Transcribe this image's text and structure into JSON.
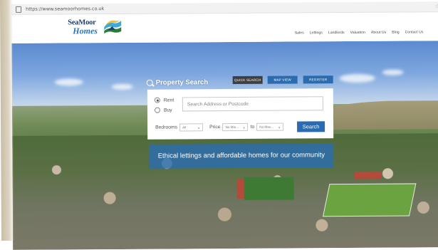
{
  "browser": {
    "url": "https://www.seamoorhomes.co.uk"
  },
  "logo": {
    "line1": "SeaMoor",
    "line2": "Homes"
  },
  "nav": {
    "items": [
      "Sales",
      "Lettings",
      "Landlords",
      "Valuation",
      "About Us",
      "Blog",
      "Contact Us"
    ]
  },
  "search": {
    "title": "Property Search",
    "tabs": {
      "quick": "QUICK SEARCH",
      "map": "MAP VIEW",
      "register": "REGISTER"
    },
    "options": {
      "rent": "Rent",
      "buy": "Buy",
      "selected": "Rent"
    },
    "placeholder": "Search Address or Postcode",
    "bedrooms_label": "Bedrooms",
    "bedrooms_value": "All",
    "price_label": "Price",
    "price_min": "No Min...",
    "to_label": "to",
    "price_max": "No Max...",
    "submit": "Search"
  },
  "tagline": "Ethical lettings and affordable homes for our community",
  "colors": {
    "primary": "#2b6cb0",
    "dark": "#3f3f3f",
    "logo_navy": "#1f3d70"
  },
  "icons": [
    "lock-icon",
    "star-icon",
    "search-icon",
    "chevron-down-icon"
  ]
}
